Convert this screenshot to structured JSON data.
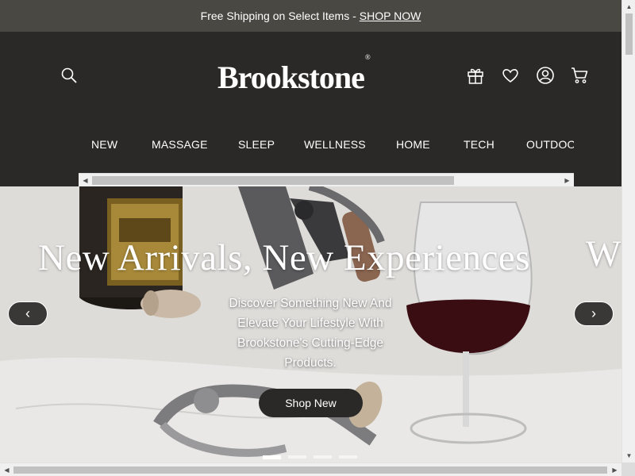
{
  "promo": {
    "text": "Free Shipping on Select Items -",
    "link": "SHOP NOW"
  },
  "header": {
    "logo_text": "Brookstone",
    "logo_mark": "®",
    "icons": [
      "search-icon",
      "gift-icon",
      "heart-icon",
      "account-icon",
      "cart-icon"
    ]
  },
  "nav": {
    "items": [
      {
        "label": "NEW"
      },
      {
        "label": "MASSAGE"
      },
      {
        "label": "SLEEP"
      },
      {
        "label": "WELLNESS"
      },
      {
        "label": "HOME"
      },
      {
        "label": "TECH"
      },
      {
        "label": "OUTDOO"
      }
    ]
  },
  "hero": {
    "headline": "New Arrivals, New Experiences",
    "next_headline_fragment": "W",
    "subtext": "Discover Something New And Elevate Your Lifestyle With Brookstone's Cutting-Edge Products.",
    "cta_label": "Shop New",
    "prev_symbol": "‹",
    "next_symbol": "›",
    "slides_count": 4,
    "active_slide": 1
  },
  "colors": {
    "header_bg": "#2b2927",
    "promo_bg": "#4a4843",
    "button_bg": "#2b2927",
    "text_light": "#ffffff"
  }
}
